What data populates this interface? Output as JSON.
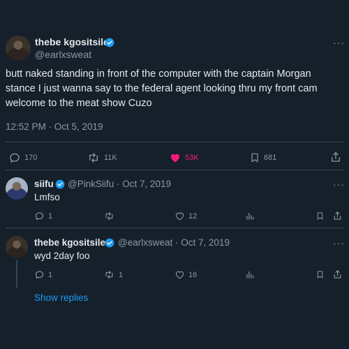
{
  "main_tweet": {
    "name": "thebe kgositsile",
    "handle": "@earlxsweat",
    "text": "butt naked standing in front of the computer with the captain Morgan stance I just wanna say to the federal agent looking thru my front cam welcome to the meat show Cuzo",
    "timestamp": "12:52 PM · Oct 5, 2019",
    "replies": "170",
    "retweets": "11K",
    "likes": "53K",
    "bookmarks": "681",
    "like_color": "#f91880"
  },
  "replies": [
    {
      "name": "siifu",
      "handle_date": "@PinkSiifu · Oct 7, 2019",
      "text": "Lmfso",
      "reply_count": "1",
      "retweet_count": "",
      "like_count": "12"
    },
    {
      "name": "thebe kgositsile",
      "handle_date": "@earlxsweat · Oct 7, 2019",
      "text": "wyd 2day foo",
      "reply_count": "1",
      "retweet_count": "1",
      "like_count": "16"
    }
  ],
  "show_replies": "Show replies",
  "more_icon": "···",
  "accent": "#1d9bf0",
  "background": "#15202b"
}
